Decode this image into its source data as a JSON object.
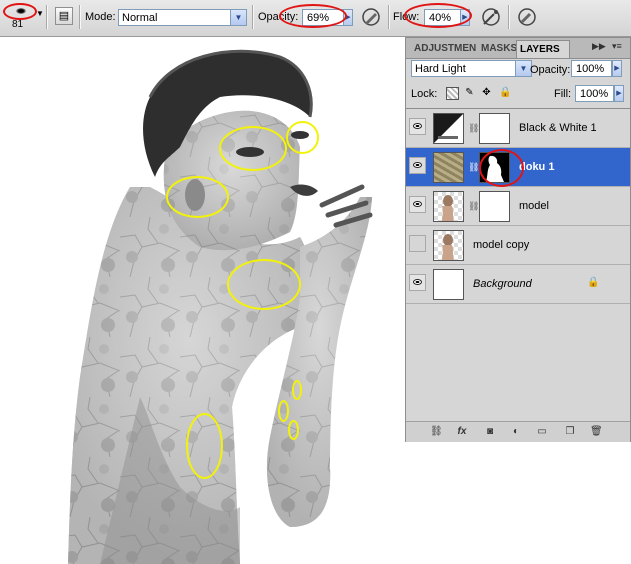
{
  "options_bar": {
    "brush_size": "81",
    "mode_label": "Mode:",
    "mode_value": "Normal",
    "opacity_label": "Opacity:",
    "opacity_value": "69%",
    "flow_label": "Flow:",
    "flow_value": "40%"
  },
  "layers_panel": {
    "tabs": [
      "ADJUSTMEN",
      "MASKS",
      "LAYERS"
    ],
    "active_tab": "LAYERS",
    "blend_mode": "Hard Light",
    "opacity_label": "Opacity:",
    "opacity_value": "100%",
    "lock_label": "Lock:",
    "fill_label": "Fill:",
    "fill_value": "100%",
    "layers": [
      {
        "name": "Black & White 1",
        "visible": true,
        "selected": false,
        "type": "adjustment"
      },
      {
        "name": "doku 1",
        "visible": true,
        "selected": true,
        "type": "texture"
      },
      {
        "name": "model",
        "visible": true,
        "selected": false,
        "type": "image"
      },
      {
        "name": "model copy",
        "visible": false,
        "selected": false,
        "type": "image"
      },
      {
        "name": "Background",
        "visible": true,
        "selected": false,
        "type": "background",
        "locked": true
      }
    ]
  },
  "icons": [
    "brush-preset-icon",
    "airbrush-icon",
    "tablet-pressure-icon",
    "link-icon",
    "fx-icon",
    "mask-icon",
    "adjustment-icon",
    "folder-icon",
    "new-layer-icon",
    "trash-icon",
    "lock-icon",
    "eye-icon"
  ],
  "colors": {
    "selection": "#3366cc",
    "annotation_red": "#e11414",
    "annotation_yellow": "#f2f20a"
  }
}
